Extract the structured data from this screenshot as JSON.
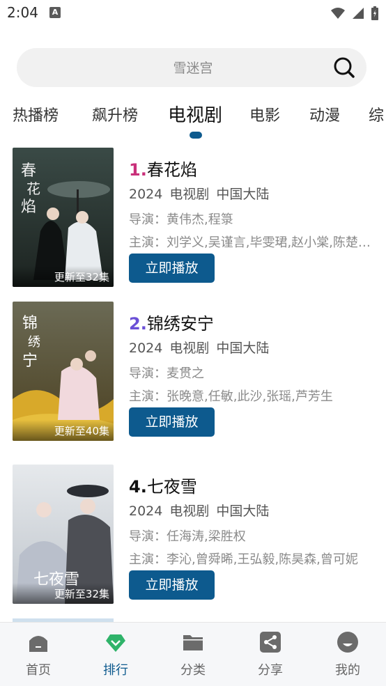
{
  "status_bar": {
    "time": "2:04",
    "notification_icon": "A"
  },
  "search": {
    "placeholder": "雪迷宫",
    "icon": "search-icon"
  },
  "tabs": [
    {
      "label": "热播榜",
      "active": false
    },
    {
      "label": "飙升榜",
      "active": false
    },
    {
      "label": "电视剧",
      "active": true
    },
    {
      "label": "电影",
      "active": false
    },
    {
      "label": "动漫",
      "active": false
    },
    {
      "label": "综",
      "active": false
    }
  ],
  "items": [
    {
      "rank": "1.",
      "title": "春花焰",
      "rank_color": "#c9307a",
      "year": "2024",
      "category": "电视剧",
      "region": "中国大陆",
      "director": "导演：黄伟杰,程箓",
      "actors": "主演：刘学义,吴谨言,毕雯珺,赵小棠,陈楚…",
      "update": "更新至32集",
      "play_label": "立即播放"
    },
    {
      "rank": "2.",
      "title": "锦绣安宁",
      "rank_color": "#6a4fd6",
      "year": "2024",
      "category": "电视剧",
      "region": "中国大陆",
      "director": "导演：麦贯之",
      "actors": "主演：张晚意,任敏,此沙,张瑶,芦芳生",
      "update": "更新至40集",
      "play_label": "立即播放"
    },
    {
      "rank": "4.",
      "title": "七夜雪",
      "rank_color": "#111111",
      "year": "2024",
      "category": "电视剧",
      "region": "中国大陆",
      "director": "导演：任海涛,梁胜权",
      "actors": "主演：李沁,曾舜晞,王弘毅,陈昊森,曾可妮",
      "update": "更新至32集",
      "play_label": "立即播放"
    }
  ],
  "bottom_nav": [
    {
      "label": "首页",
      "icon": "home-icon",
      "active": false
    },
    {
      "label": "排行",
      "icon": "ranking-icon",
      "active": true
    },
    {
      "label": "分类",
      "icon": "folder-icon",
      "active": false
    },
    {
      "label": "分享",
      "icon": "share-icon",
      "active": false
    },
    {
      "label": "我的",
      "icon": "profile-icon",
      "active": false
    }
  ],
  "colors": {
    "accent": "#0d5a8e",
    "active_nav_icon": "#2fb36a"
  }
}
